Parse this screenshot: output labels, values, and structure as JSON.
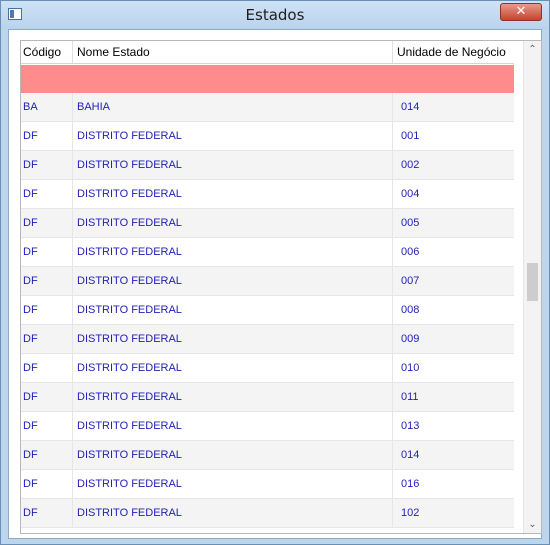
{
  "window": {
    "title": "Estados",
    "close_label": "✕"
  },
  "grid": {
    "columns": [
      "Código",
      "Nome Estado",
      "Unidade de Negócio"
    ],
    "rows": [
      {
        "codigo": "BA",
        "nome": "BAHIA",
        "unidade": "014"
      },
      {
        "codigo": "DF",
        "nome": "DISTRITO FEDERAL",
        "unidade": "001"
      },
      {
        "codigo": "DF",
        "nome": "DISTRITO FEDERAL",
        "unidade": "002"
      },
      {
        "codigo": "DF",
        "nome": "DISTRITO FEDERAL",
        "unidade": "004"
      },
      {
        "codigo": "DF",
        "nome": "DISTRITO FEDERAL",
        "unidade": "005"
      },
      {
        "codigo": "DF",
        "nome": "DISTRITO FEDERAL",
        "unidade": "006"
      },
      {
        "codigo": "DF",
        "nome": "DISTRITO FEDERAL",
        "unidade": "007"
      },
      {
        "codigo": "DF",
        "nome": "DISTRITO FEDERAL",
        "unidade": "008"
      },
      {
        "codigo": "DF",
        "nome": "DISTRITO FEDERAL",
        "unidade": "009"
      },
      {
        "codigo": "DF",
        "nome": "DISTRITO FEDERAL",
        "unidade": "010"
      },
      {
        "codigo": "DF",
        "nome": "DISTRITO FEDERAL",
        "unidade": "011"
      },
      {
        "codigo": "DF",
        "nome": "DISTRITO FEDERAL",
        "unidade": "013"
      },
      {
        "codigo": "DF",
        "nome": "DISTRITO FEDERAL",
        "unidade": "014"
      },
      {
        "codigo": "DF",
        "nome": "DISTRITO FEDERAL",
        "unidade": "016"
      },
      {
        "codigo": "DF",
        "nome": "DISTRITO FEDERAL",
        "unidade": "102"
      }
    ]
  },
  "scrollbar": {
    "up_icon": "chevron-up-icon",
    "down_icon": "chevron-down-icon"
  },
  "colors": {
    "filter_row": "#ff8c8c",
    "cell_text": "#1f1fb4"
  }
}
